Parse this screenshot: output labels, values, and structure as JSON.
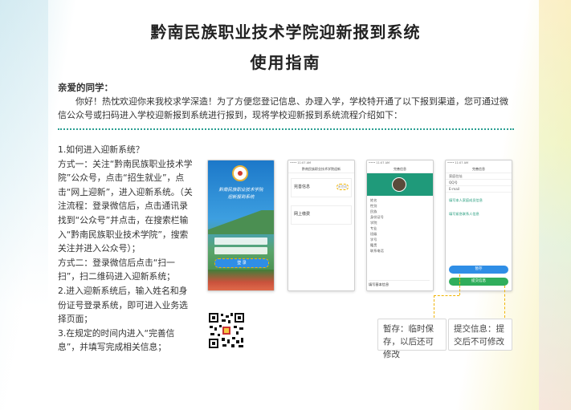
{
  "header": {
    "title": "黔南民族职业技术学院迎新报到系统",
    "subtitle": "使用指南"
  },
  "greeting": "亲爱的同学：",
  "intro": "你好！热忱欢迎你来我校求学深造！为了方便您登记信息、办理入学，学校特开通了以下报到渠道，您可通过微信公众号或扫码进入学校迎新报到系统进行报到，现将学校迎新报到系统流程介绍如下：",
  "steps": [
    "1.如何进入迎新系统？",
    "方式一：关注“黔南民族职业技术学院”公众号，点击“招生就业”，点击“网上迎新”，进入迎新系统。（关注流程：登录微信后，点击通讯录找到“公众号”并点击，在搜索栏输入“黔南民族职业技术学院”，搜索关注并进入公众号）；",
    "方式二：登录微信后点击“扫一扫”，扫二维码进入迎新系统；",
    "2.进入迎新系统后，输入姓名和身份证号登录系统，即可进入业务选择页面；",
    "3.在规定的时间内进入“完善信息”，并填写完成相关信息；"
  ],
  "phones": {
    "p1": {
      "school": "黔南民族职业技术学院",
      "subtitle": "迎新报到系统",
      "login": "登 录"
    },
    "p2": {
      "nav": "黔南民族职业技术学院迎新",
      "item1": "完善信息",
      "item2": "网上缴费",
      "badge": "未完成"
    },
    "p3": {
      "nav": "完善信息",
      "rows": [
        "姓名",
        "性别",
        "民族",
        "身份证号",
        "学院",
        "专业",
        "班级",
        "学号",
        "籍贯",
        "联系电话"
      ],
      "footer": "填写基本信息"
    },
    "p4": {
      "nav": "完善信息",
      "rows": [
        "家庭住址",
        "QQ号",
        "E-mail",
        "填写本人家庭成员信息",
        "填写紧急联系人信息"
      ],
      "btn_save": "暂存",
      "btn_submit": "提交信息"
    }
  },
  "callouts": {
    "save": "暂存：临时保存，以后还可修改",
    "submit": "提交信息：提交后不可修改"
  },
  "colors": {
    "accent": "#2a9f92",
    "button_blue": "#2f8ee6",
    "button_green": "#2fae5c",
    "dash": "#f0b400"
  }
}
